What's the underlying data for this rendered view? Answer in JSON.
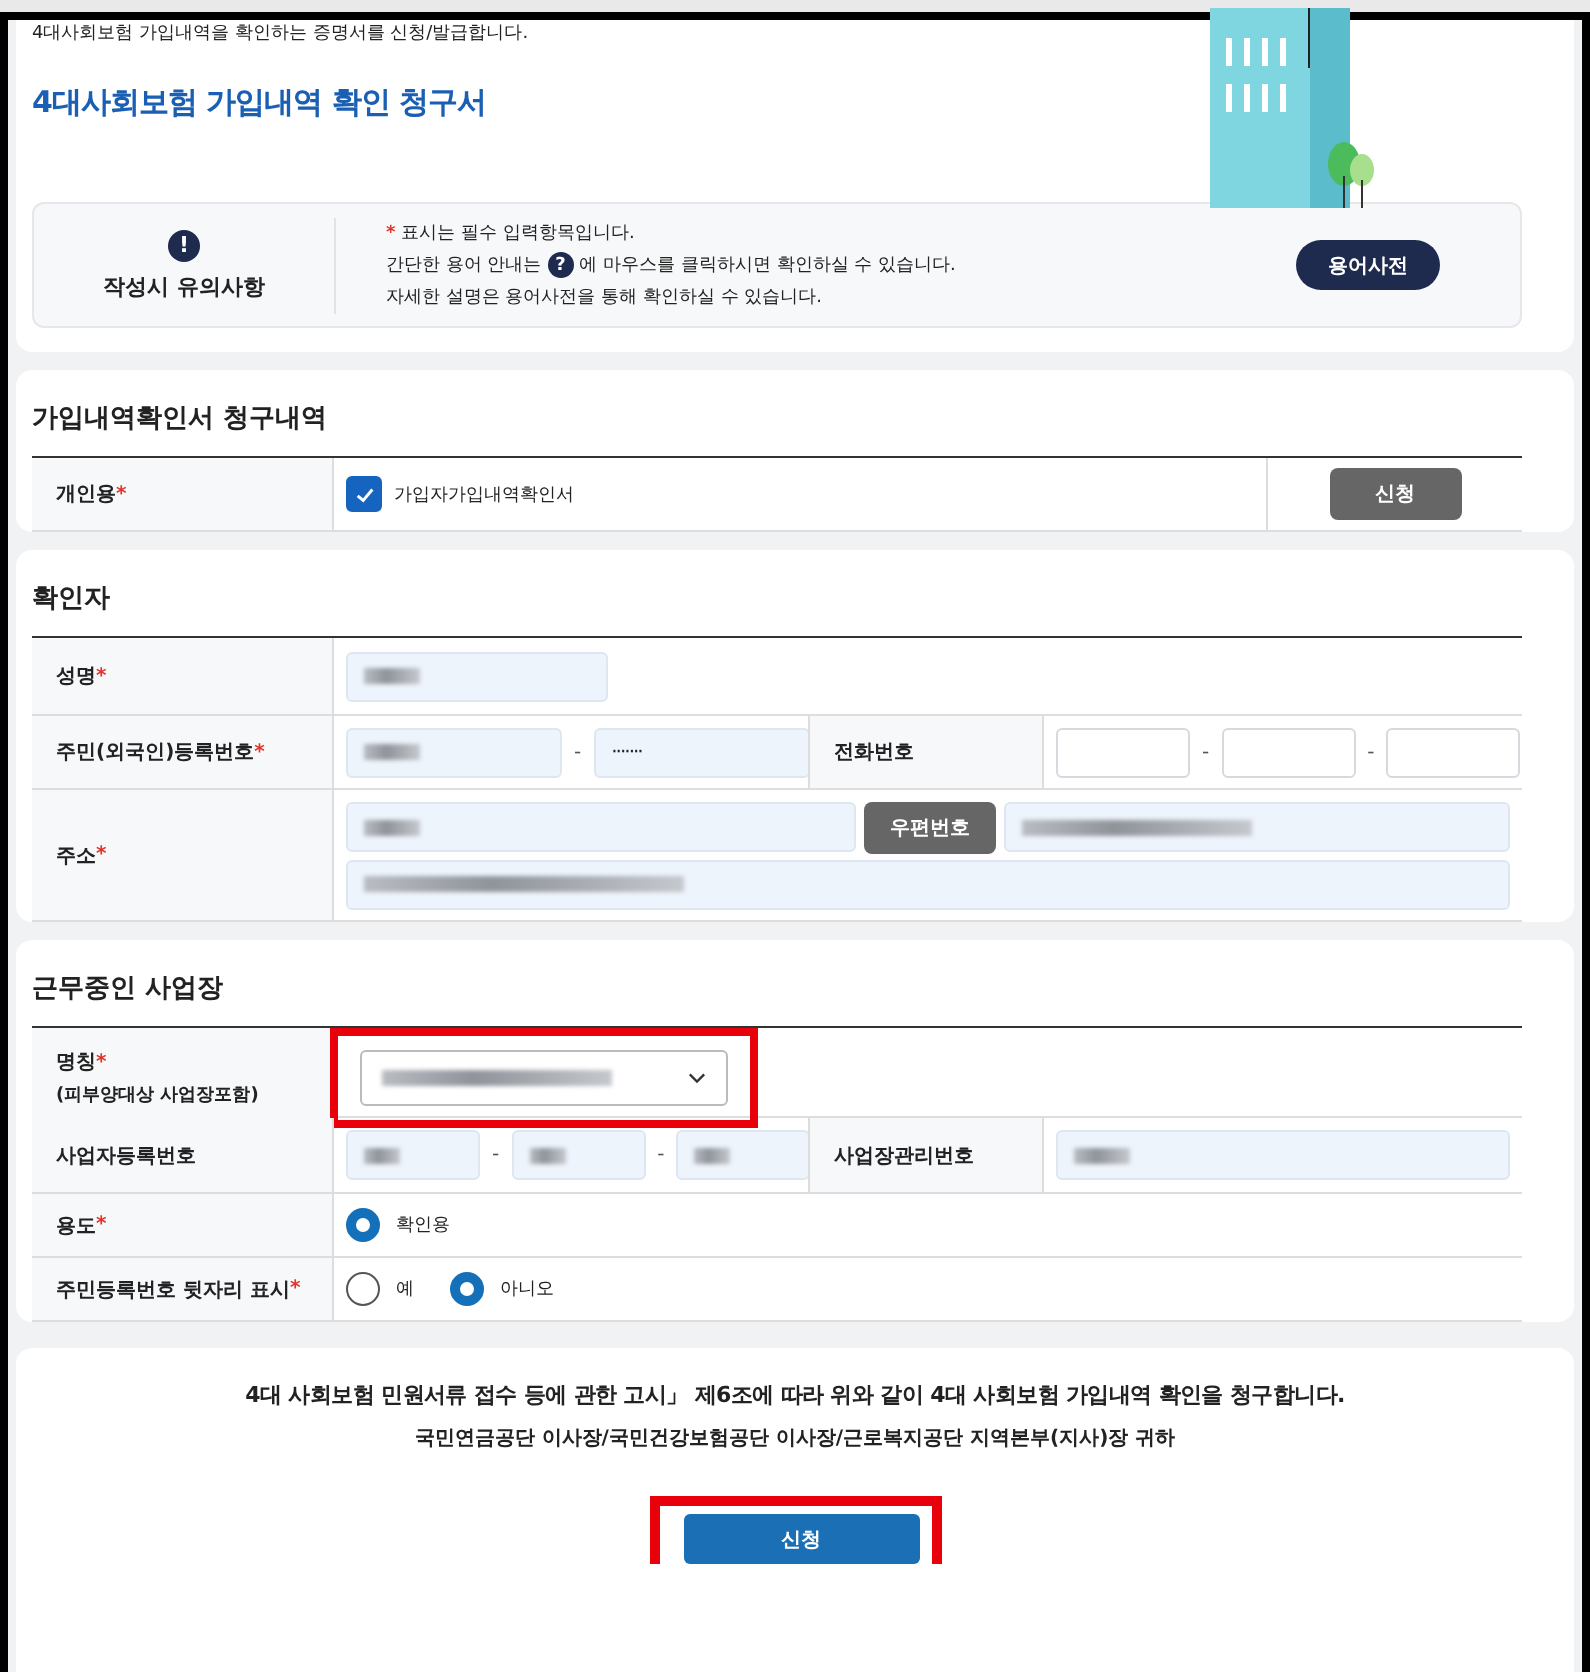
{
  "intro": "4대사회보험 가입내역을 확인하는 증명서를 신청/발급합니다.",
  "title": "4대사회보험 가입내역 확인 청구서",
  "required_mark": "*",
  "notice": {
    "heading": "작성시 유의사항",
    "icon": "!",
    "required_text": "표시는 필수 입력항목입니다.",
    "help_before": "간단한 용어 안내는",
    "help_icon": "?",
    "help_after": "에 마우스를 클릭하시면 확인하실 수 있습니다.",
    "detail": "자세한 설명은 용어사전을 통해 확인하실 수 있습니다.",
    "button": "용어사전"
  },
  "request": {
    "heading": "가입내역확인서 청구내역",
    "label": "개인용",
    "required": true,
    "option": {
      "label": "가입자가입내역확인서",
      "checked": true
    },
    "button": "신청"
  },
  "confirmer": {
    "heading": "확인자",
    "name": {
      "label": "성명",
      "required": true,
      "field": {
        "filled": true
      }
    },
    "resident_no": {
      "label": "주민(외국인)등록번호",
      "required": true,
      "separator": "-",
      "fields": [
        {
          "filled": true
        },
        {
          "filled": true,
          "value": "·······"
        }
      ]
    },
    "phone": {
      "label": "전화번호",
      "required": false,
      "separator": "-",
      "fields": [
        {
          "filled": false
        },
        {
          "filled": false
        },
        {
          "filled": false
        }
      ]
    },
    "address": {
      "label": "주소",
      "required": true,
      "postcode_button": "우편번호",
      "fields": [
        {
          "filled": true
        },
        {
          "filled": true
        },
        {
          "filled": true
        }
      ]
    }
  },
  "workplace": {
    "heading": "근무중인 사업장",
    "name": {
      "label": "명칭",
      "required": true,
      "note": "(피부양대상 사업장포함)",
      "select": {
        "filled": true,
        "highlighted": true
      }
    },
    "biz_no": {
      "label": "사업자등록번호",
      "required": false,
      "separator": "-",
      "fields": [
        {
          "filled": true
        },
        {
          "filled": true
        },
        {
          "filled": true
        }
      ]
    },
    "mgmt_no": {
      "label": "사업장관리번호",
      "required": false,
      "field": {
        "filled": true
      }
    },
    "purpose": {
      "label": "용도",
      "required": true,
      "options": [
        {
          "label": "확인용",
          "selected": true
        }
      ]
    },
    "show_resident": {
      "label": "주민등록번호 뒷자리 표시",
      "required": true,
      "options": [
        {
          "label": "예",
          "selected": false
        },
        {
          "label": "아니오",
          "selected": true
        }
      ]
    }
  },
  "footer": {
    "statement": "4대 사회보험 민원서류 접수 등에 관한 고시」 제6조에 따라 위와 같이 4대 사회보험 가입내역 확인을 청구합니다.",
    "addressee": "국민연금공단 이사장/국민건강보험공단 이사장/근로복지공단 지역본부(지사)장 귀하",
    "submit": {
      "label": "신청",
      "highlighted": true
    }
  }
}
